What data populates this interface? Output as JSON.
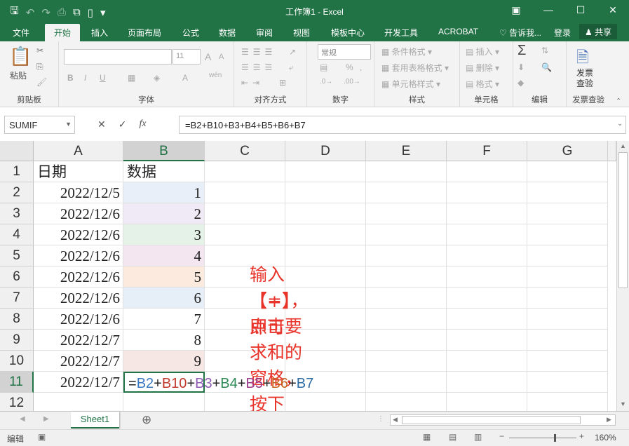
{
  "window": {
    "title": "工作簿1 - Excel",
    "controls": {
      "restore_icon": "restore-icon",
      "minimize": "—",
      "maximize": "☐",
      "close": "✕"
    }
  },
  "ribbon_tabs": [
    "文件",
    "开始",
    "插入",
    "页面布局",
    "公式",
    "数据",
    "审阅",
    "视图",
    "模板中心",
    "开发工具",
    "ACROBAT"
  ],
  "tell_me": "告诉我...",
  "login": "登录",
  "share": "共享",
  "ribbon": {
    "clipboard": {
      "paste": "粘贴",
      "label": "剪贴板"
    },
    "font": {
      "font_size": "11",
      "label": "字体"
    },
    "alignment": {
      "label": "对齐方式"
    },
    "number": {
      "format": "常规",
      "label": "数字"
    },
    "styles": {
      "conditional": "条件格式",
      "table": "套用表格格式",
      "cell": "单元格样式",
      "label": "样式"
    },
    "cells": {
      "insert": "插入",
      "delete": "删除",
      "format": "格式",
      "label": "单元格"
    },
    "editing": {
      "label": "编辑"
    },
    "invoice": {
      "button_line1": "发票",
      "button_line2": "查验",
      "label": "发票查验"
    }
  },
  "formula_bar": {
    "name_box": "SUMIF",
    "cancel": "✕",
    "enter": "✓",
    "fx": "fx",
    "formula": "=B2+B10+B3+B4+B5+B6+B7"
  },
  "columns": [
    "A",
    "B",
    "C",
    "D",
    "E",
    "F",
    "G"
  ],
  "rows": [
    "1",
    "2",
    "3",
    "4",
    "5",
    "6",
    "7",
    "8",
    "9",
    "10",
    "11",
    "12"
  ],
  "cells": {
    "A": [
      "日期",
      "2022/12/5",
      "2022/12/6",
      "2022/12/6",
      "2022/12/6",
      "2022/12/6",
      "2022/12/6",
      "2022/12/6",
      "2022/12/7",
      "2022/12/7",
      "2022/12/7",
      ""
    ],
    "B": [
      "数据",
      "1",
      "2",
      "3",
      "4",
      "5",
      "6",
      "7",
      "8",
      "9",
      "",
      ""
    ]
  },
  "formula_parts": [
    {
      "text": "=",
      "color": "#222222"
    },
    {
      "text": "B2",
      "color": "#3a78c2"
    },
    {
      "text": "+",
      "color": "#222222"
    },
    {
      "text": "B10",
      "color": "#c0392b"
    },
    {
      "text": "+",
      "color": "#222222"
    },
    {
      "text": "B3",
      "color": "#8e5bb5"
    },
    {
      "text": "+",
      "color": "#222222"
    },
    {
      "text": "B4",
      "color": "#2e8b57"
    },
    {
      "text": "+",
      "color": "#222222"
    },
    {
      "text": "B5",
      "color": "#9b3a8a"
    },
    {
      "text": "+",
      "color": "#222222"
    },
    {
      "text": "B6",
      "color": "#c8621e"
    },
    {
      "text": "+",
      "color": "#222222"
    },
    {
      "text": "B7",
      "color": "#2e6da4"
    }
  ],
  "annotation": {
    "line1": "输入【=】，点击要求和的窗格，按下",
    "line2": "【+】即可"
  },
  "sheet_tabs": [
    "Sheet1"
  ],
  "status": {
    "mode": "编辑",
    "zoom": "160%"
  },
  "colors": {
    "excel_green": "#217346",
    "annotation_red": "#e8342a"
  }
}
